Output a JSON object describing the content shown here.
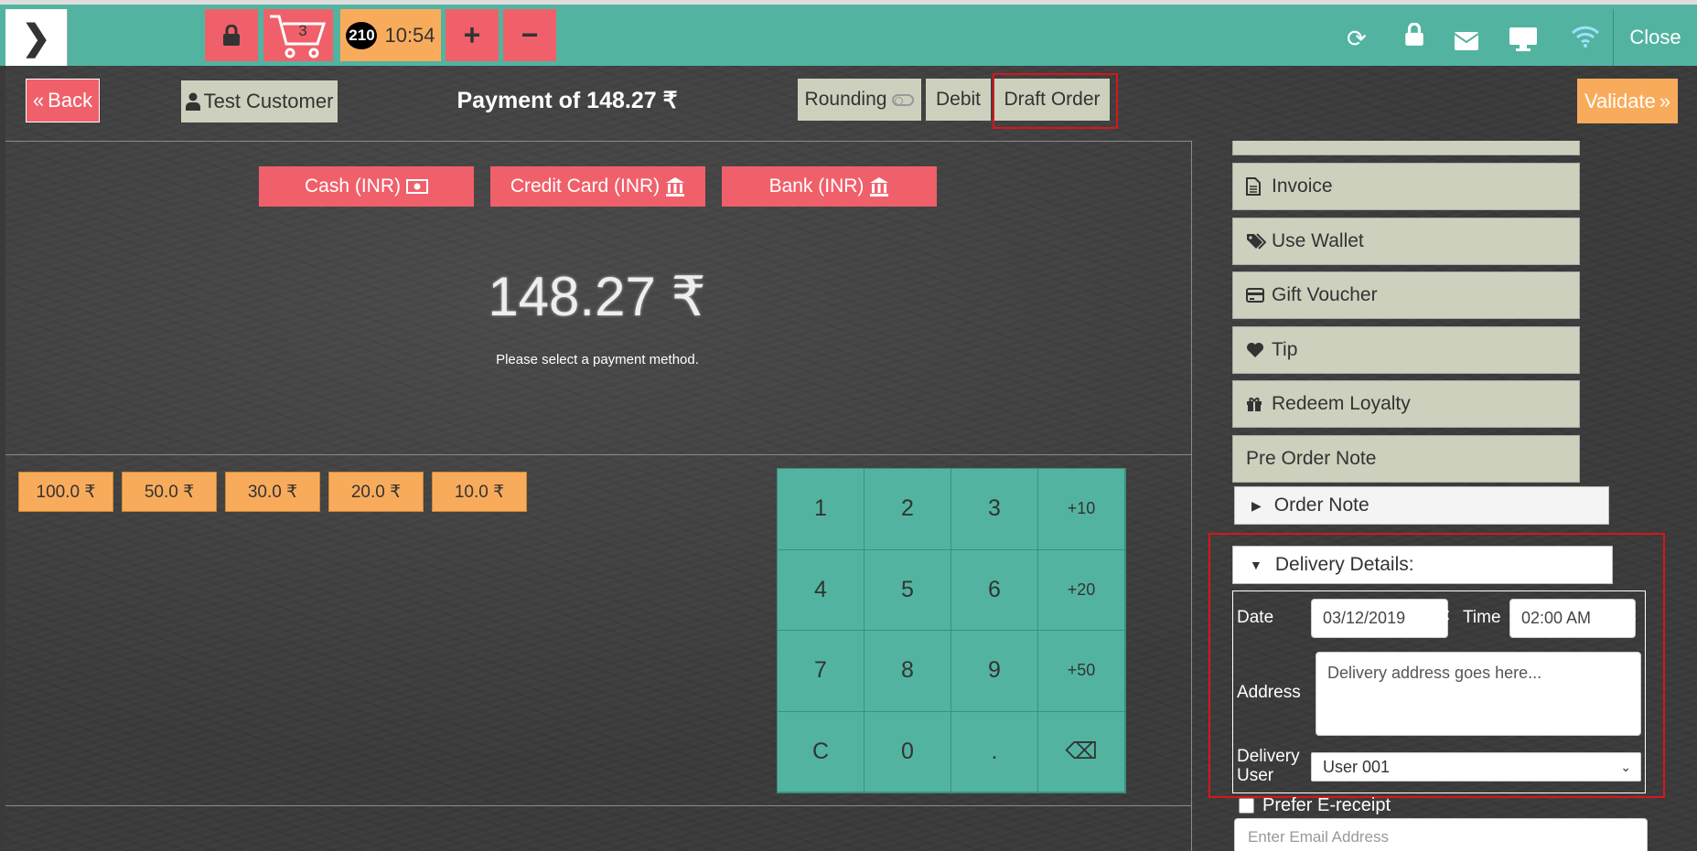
{
  "topbar": {
    "menu_icon": "chevron-right-icon",
    "order_count": "210",
    "cart_count": "3",
    "clock": "10:54",
    "close_label": "Close",
    "accent": "#52b4a0"
  },
  "header": {
    "back_label": "Back",
    "customer_label": "Test Customer",
    "title": "Payment of 148.27 ₹",
    "rounding_label": "Rounding",
    "debit_label": "Debit",
    "draft_label": "Draft Order",
    "validate_label": "Validate"
  },
  "payment_methods": [
    {
      "label": "Cash (INR)",
      "icon": "money-icon"
    },
    {
      "label": "Credit Card (INR)",
      "icon": "bank-icon"
    },
    {
      "label": "Bank (INR)",
      "icon": "bank-icon"
    }
  ],
  "amount": "148.27 ₹",
  "hint": "Please select a payment method.",
  "quick_amounts": [
    "100.0 ₹",
    "50.0 ₹",
    "30.0 ₹",
    "20.0 ₹",
    "10.0 ₹"
  ],
  "numpad": [
    "1",
    "2",
    "3",
    "+10",
    "4",
    "5",
    "6",
    "+20",
    "7",
    "8",
    "9",
    "+50",
    "C",
    "0",
    ".",
    "⌫"
  ],
  "sidebar": {
    "items": [
      {
        "label": "Invoice",
        "icon": "document-icon"
      },
      {
        "label": "Use Wallet",
        "icon": "tags-icon"
      },
      {
        "label": "Gift Voucher",
        "icon": "credit-card-icon"
      },
      {
        "label": "Tip",
        "icon": "heart-icon"
      },
      {
        "label": "Redeem Loyalty",
        "icon": "gift-icon"
      },
      {
        "label": "Pre Order Note",
        "icon": ""
      }
    ],
    "order_note": "Order Note",
    "delivery_title": "Delivery Details:"
  },
  "delivery": {
    "date_label": "Date",
    "date_value": "03/12/2019",
    "time_label": "Time",
    "time_value": "02:00 AM",
    "address_label": "Address",
    "address_placeholder": "Delivery address goes here...",
    "user_label_1": "Delivery",
    "user_label_2": "User",
    "user_value": "User 001"
  },
  "ereceipt": {
    "label": "Prefer E-receipt",
    "email_placeholder": "Enter Email Address"
  }
}
